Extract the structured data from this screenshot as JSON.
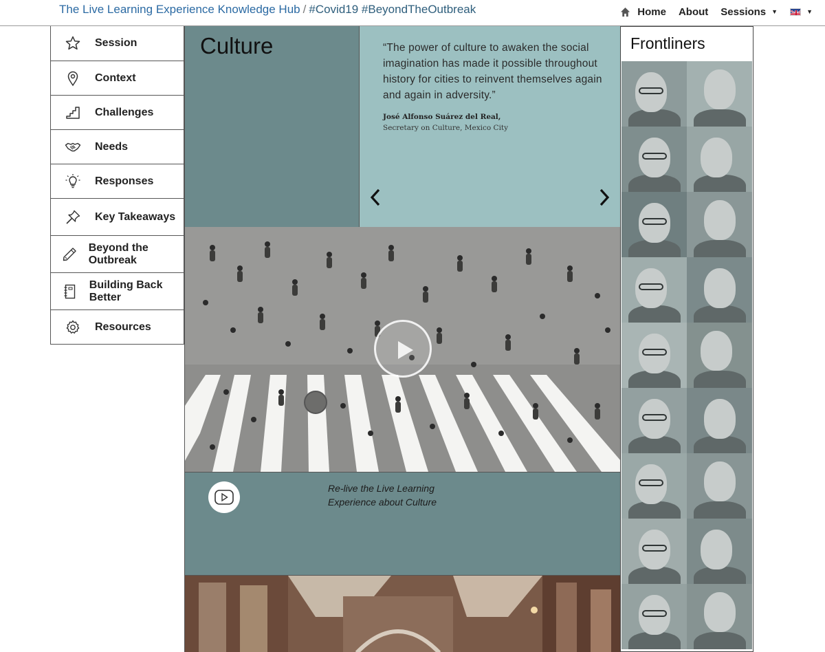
{
  "header": {
    "site_title": "The Live Learning Experience Knowledge Hub",
    "separator": "/",
    "tags": "#Covid19 #BeyondTheOutbreak",
    "nav": {
      "home": "Home",
      "about": "About",
      "sessions": "Sessions"
    },
    "language_flag": "uk-flag-icon"
  },
  "sidebar": {
    "items": [
      {
        "label": "Session",
        "icon": "star-icon"
      },
      {
        "label": "Context",
        "icon": "map-pin-icon"
      },
      {
        "label": "Challenges",
        "icon": "stairs-icon"
      },
      {
        "label": "Needs",
        "icon": "handshake-icon"
      },
      {
        "label": "Responses",
        "icon": "lightbulb-icon"
      },
      {
        "label": "Key Takeaways",
        "icon": "pin-icon"
      },
      {
        "label": "Beyond the Outbreak",
        "icon": "pencil-icon"
      },
      {
        "label": "Building Back Better",
        "icon": "notebook-icon"
      },
      {
        "label": "Resources",
        "icon": "gear-icon"
      }
    ]
  },
  "main": {
    "title": "Culture",
    "quote": {
      "text": "“The power of culture to awaken the social imagination has made it possible throughout history for cities to reinvent themselves again and again in adversity.”",
      "author": "José Alfonso Suárez del Real,",
      "role": "Secretary on Culture, Mexico City"
    },
    "caption": "Re-live the Live Learning Experience about Culture"
  },
  "frontliners": {
    "title": "Frontliners"
  },
  "colors": {
    "panel_dark": "#6c8a8c",
    "panel_light": "#9cc0c1",
    "link_blue": "#2b6aa3"
  }
}
